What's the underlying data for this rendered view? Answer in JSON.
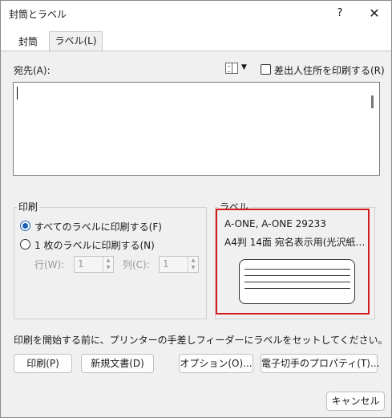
{
  "window": {
    "title": "封筒とラベル",
    "help_label": "?",
    "close_label": "✕"
  },
  "tabs": [
    {
      "label": "封筒"
    },
    {
      "label": "ラベル(L)"
    }
  ],
  "address": {
    "label": "宛先(A):",
    "value": "",
    "address_book_icon": "address-book-icon",
    "dropdown_glyph": "▼",
    "use_return_address": {
      "label": "差出人住所を印刷する(R)",
      "checked": false
    }
  },
  "print_group": {
    "title": "印刷",
    "options": [
      {
        "label": "すべてのラベルに印刷する(F)",
        "selected": true
      },
      {
        "label": "1 枚のラベルに印刷する(N)",
        "selected": false
      }
    ],
    "row": {
      "label": "行(W):",
      "value": "1"
    },
    "column": {
      "label": "列(C):",
      "value": "1"
    },
    "spin_up": "▲",
    "spin_down": "▼"
  },
  "label_group": {
    "title": "ラベル",
    "name": "A-ONE, A-ONE 29233",
    "description": "A4判 14面 宛名表示用(光沢紙…"
  },
  "hint_text": "印刷を開始する前に、プリンターの手差しフィーダーにラベルをセットしてください。",
  "buttons": {
    "print": "印刷(P)",
    "new_document": "新規文書(D)",
    "options": "オプション(O)...",
    "epostage": "電子切手のプロパティ(T)...",
    "cancel": "キャンセル"
  },
  "colors": {
    "highlight_border": "#d21b1b",
    "radio_selected": "#1a5fb4"
  }
}
